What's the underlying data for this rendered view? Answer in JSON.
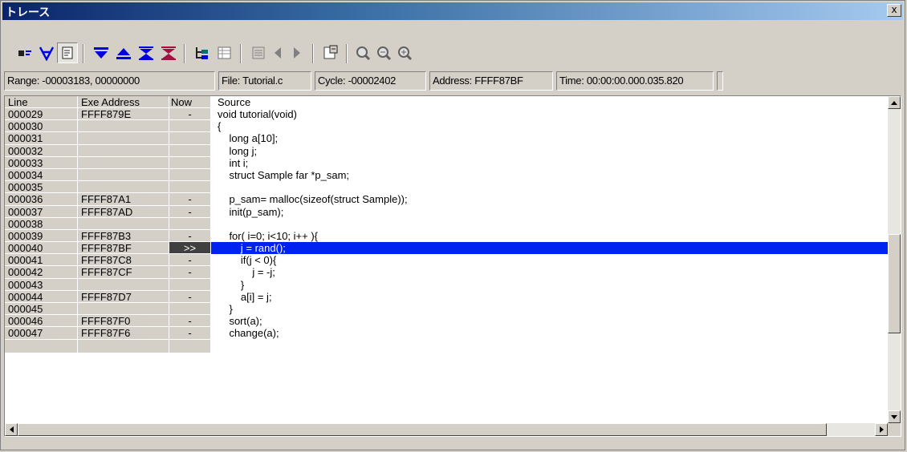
{
  "window": {
    "title": "トレース",
    "close_label": "x"
  },
  "status": {
    "range": "Range: -00003183, 00000000",
    "file": "File: Tutorial.c",
    "cycle": "Cycle: -00002402",
    "address": "Address: FFFF87BF",
    "time": "Time: 00:00:00.000.035.820",
    "extra": ""
  },
  "columns": {
    "line": "Line",
    "address": "Exe Address",
    "now": "Now",
    "source": "Source"
  },
  "rows": [
    {
      "line": "000029",
      "addr": "FFFF879E",
      "now": "-",
      "src": "void tutorial(void)"
    },
    {
      "line": "000030",
      "addr": "",
      "now": "",
      "src": "{"
    },
    {
      "line": "000031",
      "addr": "",
      "now": "",
      "src": "    long a[10];"
    },
    {
      "line": "000032",
      "addr": "",
      "now": "",
      "src": "    long j;"
    },
    {
      "line": "000033",
      "addr": "",
      "now": "",
      "src": "    int i;"
    },
    {
      "line": "000034",
      "addr": "",
      "now": "",
      "src": "    struct Sample far *p_sam;"
    },
    {
      "line": "000035",
      "addr": "",
      "now": "",
      "src": ""
    },
    {
      "line": "000036",
      "addr": "FFFF87A1",
      "now": "-",
      "src": "    p_sam= malloc(sizeof(struct Sample));"
    },
    {
      "line": "000037",
      "addr": "FFFF87AD",
      "now": "-",
      "src": "    init(p_sam);"
    },
    {
      "line": "000038",
      "addr": "",
      "now": "",
      "src": ""
    },
    {
      "line": "000039",
      "addr": "FFFF87B3",
      "now": "-",
      "src": "    for( i=0; i<10; i++ ){"
    },
    {
      "line": "000040",
      "addr": "FFFF87BF",
      "now": ">>",
      "src": "        j = rand();"
    },
    {
      "line": "000041",
      "addr": "FFFF87C8",
      "now": "-",
      "src": "        if(j < 0){"
    },
    {
      "line": "000042",
      "addr": "FFFF87CF",
      "now": "-",
      "src": "            j = -j;"
    },
    {
      "line": "000043",
      "addr": "",
      "now": "",
      "src": "        }"
    },
    {
      "line": "000044",
      "addr": "FFFF87D7",
      "now": "-",
      "src": "        a[i] = j;"
    },
    {
      "line": "000045",
      "addr": "",
      "now": "",
      "src": "    }"
    },
    {
      "line": "000046",
      "addr": "FFFF87F0",
      "now": "-",
      "src": "    sort(a);"
    },
    {
      "line": "000047",
      "addr": "FFFF87F6",
      "now": "-",
      "src": "    change(a);"
    }
  ],
  "current_line": "000040",
  "colors": {
    "highlight": "#0022f0",
    "toolbar_blue": "#0000e0",
    "toolbar_green": "#007070"
  },
  "toolbar_icons": [
    "trace-mode-icon",
    "filter-icon",
    "source-view-icon",
    "down-triangle-icon",
    "up-triangle-icon",
    "down-trace-icon",
    "up-trace-icon",
    "tree-icon",
    "grid-icon",
    "list-icon",
    "left-arrow-icon",
    "right-arrow-icon",
    "properties-icon",
    "find-icon",
    "find-next-icon",
    "find-prev-icon"
  ]
}
